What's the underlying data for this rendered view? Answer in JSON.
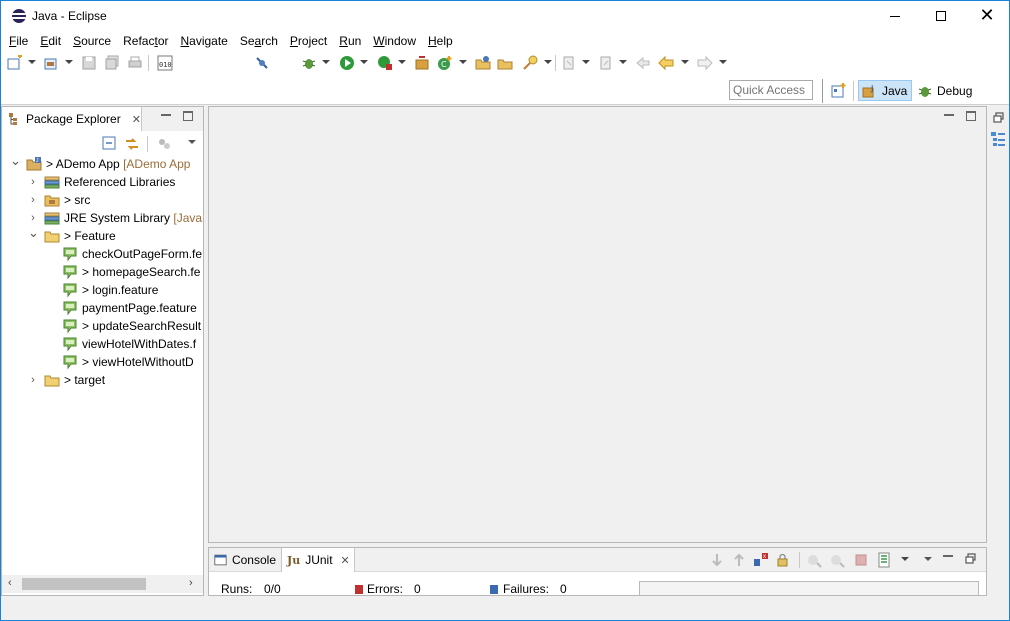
{
  "window": {
    "title": "Java - Eclipse"
  },
  "menu": [
    {
      "pre": "",
      "u": "F",
      "post": "ile"
    },
    {
      "pre": "",
      "u": "E",
      "post": "dit"
    },
    {
      "pre": "",
      "u": "S",
      "post": "ource"
    },
    {
      "pre": "Refac",
      "u": "t",
      "post": "or"
    },
    {
      "pre": "",
      "u": "N",
      "post": "avigate"
    },
    {
      "pre": "Se",
      "u": "a",
      "post": "rch"
    },
    {
      "pre": "",
      "u": "P",
      "post": "roject"
    },
    {
      "pre": "",
      "u": "R",
      "post": "un"
    },
    {
      "pre": "",
      "u": "W",
      "post": "indow"
    },
    {
      "pre": "",
      "u": "H",
      "post": "elp"
    }
  ],
  "perspective": {
    "quick_access_placeholder": "Quick Access",
    "java_label": "Java",
    "debug_label": "Debug"
  },
  "package_explorer": {
    "tab_label": "Package Explorer",
    "tree": [
      {
        "level": 0,
        "twisty": "down",
        "icon": "project-icon",
        "prefix": "> ",
        "label": "ADemo App",
        "decoration": " [ADemo App"
      },
      {
        "level": 1,
        "twisty": "right",
        "icon": "library-icon",
        "prefix": "",
        "label": "Referenced Libraries",
        "decoration": ""
      },
      {
        "level": 1,
        "twisty": "right",
        "icon": "source-folder-icon",
        "prefix": "> ",
        "label": "src",
        "decoration": ""
      },
      {
        "level": 1,
        "twisty": "right",
        "icon": "library-icon",
        "prefix": "",
        "label": "JRE System Library",
        "decoration": " [JavaSE"
      },
      {
        "level": 1,
        "twisty": "down",
        "icon": "folder-icon",
        "prefix": "> ",
        "label": "Feature",
        "decoration": ""
      },
      {
        "level": 2,
        "twisty": "",
        "icon": "feature-file-icon",
        "prefix": "",
        "label": "checkOutPageForm.fe",
        "decoration": ""
      },
      {
        "level": 2,
        "twisty": "",
        "icon": "feature-file-icon",
        "prefix": "> ",
        "label": "homepageSearch.fe",
        "decoration": ""
      },
      {
        "level": 2,
        "twisty": "",
        "icon": "feature-file-icon",
        "prefix": "> ",
        "label": "login.feature",
        "decoration": ""
      },
      {
        "level": 2,
        "twisty": "",
        "icon": "feature-file-icon",
        "prefix": "",
        "label": "paymentPage.feature",
        "decoration": ""
      },
      {
        "level": 2,
        "twisty": "",
        "icon": "feature-file-icon",
        "prefix": "> ",
        "label": "updateSearchResult",
        "decoration": ""
      },
      {
        "level": 2,
        "twisty": "",
        "icon": "feature-file-icon",
        "prefix": "",
        "label": "viewHotelWithDates.f",
        "decoration": ""
      },
      {
        "level": 2,
        "twisty": "",
        "icon": "feature-file-icon",
        "prefix": "> ",
        "label": "viewHotelWithoutD",
        "decoration": ""
      },
      {
        "level": 1,
        "twisty": "right",
        "icon": "folder-icon",
        "prefix": "> ",
        "label": "target",
        "decoration": ""
      }
    ]
  },
  "bottom_panel": {
    "tabs": {
      "console": "Console",
      "junit": "JUnit"
    },
    "junit": {
      "runs_label": "Runs:",
      "runs_value": "0/0",
      "errors_label": "Errors:",
      "errors_value": "0",
      "failures_label": "Failures:",
      "failures_value": "0"
    }
  },
  "colors": {
    "accent": "#1883d7",
    "perspective_active": "#cce4f7"
  }
}
